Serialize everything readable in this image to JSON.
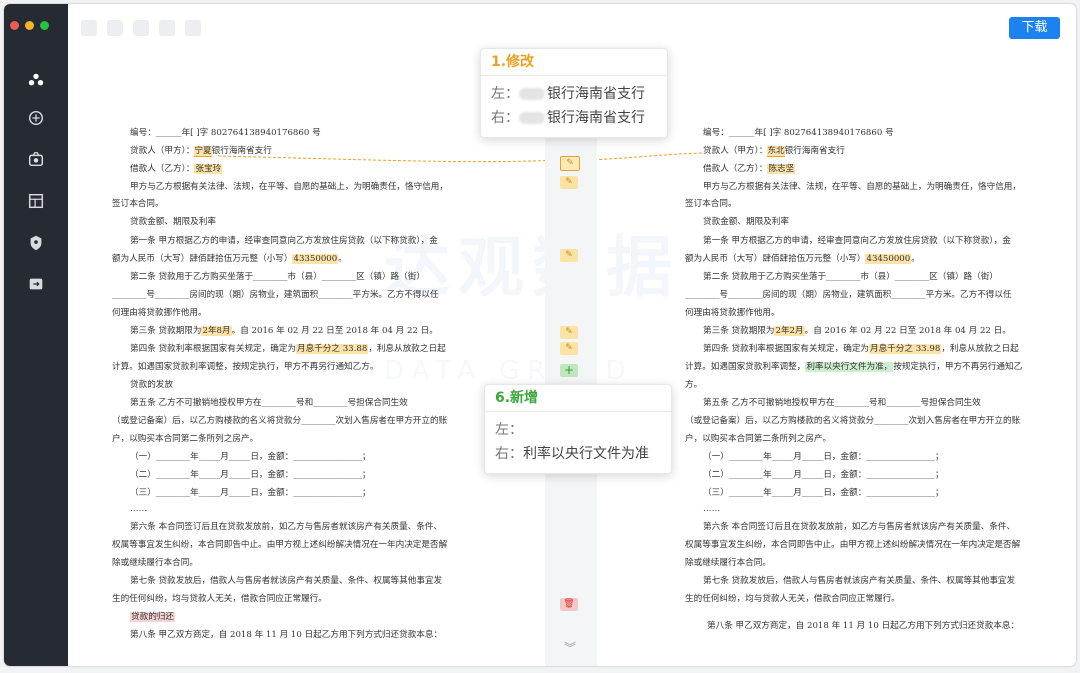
{
  "window": {
    "traffic_lights": [
      {
        "name": "close",
        "color": "#ee5b55"
      },
      {
        "name": "minimize",
        "color": "#f6b12d"
      },
      {
        "name": "maximize",
        "color": "#27c143"
      }
    ],
    "accent_color": "#1b82f0"
  },
  "sidebar": {
    "icons": [
      "logo-icon",
      "compare-icon",
      "scan-icon",
      "layout-icon",
      "shield-icon",
      "export-icon"
    ]
  },
  "toolbar": {
    "download_label": "下载"
  },
  "watermark": {
    "text": "达观数据",
    "subtext": "DATA GRAND"
  },
  "left_doc": {
    "line1": "编号：______年[ ]字 802764138940176860 号",
    "lender_label": "贷款人（甲方）：",
    "lender_hl": "宁夏",
    "lender_rest": "银行海南省支行",
    "borrower_label": "借款人（乙方）：",
    "borrower_name": "张宝玲",
    "p1": "甲方与乙方根据有关法律、法规，在平等、自愿的基础上，为明确责任，恪守信用，",
    "p1b": "签订本合同。",
    "h1": "贷款金额、期限及利率",
    "a1": "第一条  甲方根据乙方的申请，经审查同意向乙方发放住房贷款（以下称贷款），金",
    "a1b_pre": "额为人民币（大写）肆佰肆拾伍万元整（小写）",
    "a1b_amt": "43350000",
    "a1b_post": "。",
    "a2": "第二条  贷款用于乙方购买坐落于________市（县）________区（镇）路（街）",
    "a2b": "________号________房间的现（期）房物业，建筑面积________平方米。乙方不得以任",
    "a2c": "何理由将贷款挪作他用。",
    "a3_pre": "第三条  贷款期限为",
    "a3_hl": "2年8月",
    "a3_post": "。自 2016 年 02 月 22 日至 2018 年 04 月 22 日。",
    "a4_pre": "第四条  贷款利率根据国家有关规定，确定为",
    "a4_hl": "月息千分之 33.88",
    "a4_post": "，利息从放款之日起",
    "a4b": "计算。如遇国家贷款利率调整，按规定执行，甲方不再另行通知乙方。",
    "h2": "贷款的发放",
    "a5": "第五条  乙方不可撤销地授权甲方在________号和________号担保合同生效",
    "a5b": "（或登记备案）后，以乙方购楼款的名义将贷款分________次划入售房者在甲方开立的账",
    "a5c": "户，以购买本合同第二条所列之房产。",
    "i1": "（一）________年_____月_____日，金额：________________；",
    "i2": "（二）________年_____月_____日，金额：________________；",
    "i3": "（三）________年_____月_____日，金额：________________；",
    "dots": "……",
    "a6": "第六条  本合同签订后且在贷款发放前，如乙方与售房者就该房产有关质量、条件、",
    "a6b": "权属等事宜发生纠纷，本合同即告中止。由甲方视上述纠纷解决情况在一年内决定是否解",
    "a6c": "除或继续履行本合同。",
    "a7": "第七条  贷款发放后，借款人与售房者就该房产有关质量、条件、权属等其他事宜发",
    "a7b": "生的任何纠纷，均与贷款人无关，借款合同应正常履行。",
    "h3": "贷款的归还",
    "a8": "第八条  甲乙双方商定，自 2018 年 11 月 10 日起乙方用下列方式归还贷款本息："
  },
  "right_doc": {
    "line1": "编号：______年[ ]字 802764138940176860 号",
    "lender_label": "贷款人（甲方）：",
    "lender_hl": "东北",
    "lender_rest": "银行海南省支行",
    "borrower_label": "借款人（乙方）：",
    "borrower_name": "陈志坚",
    "p1": "甲方与乙方根据有关法律、法规，在平等、自愿的基础上，为明确责任，恪守信用，",
    "p1b": "签订本合同。",
    "h1": "贷款金额、期限及利率",
    "a1": "第一条  甲方根据乙方的申请，经审查同意向乙方发放住房贷款（以下称贷款），金",
    "a1b_pre": "额为人民币（大写）肆佰肆拾伍万元整（小写）",
    "a1b_amt": "43450000",
    "a1b_post": "。",
    "a2": "第二条  贷款用于乙方购买坐落于________市（县）________区（镇）路（街）",
    "a2b": "________号________房间的现（期）房物业，建筑面积________平方米。乙方不得以任",
    "a2c": "何理由将贷款挪作他用。",
    "a3_pre": "第三条  贷款期限为",
    "a3_hl": "2年2月",
    "a3_post": "。自 2016 年 02 月 22 日至 2018 年 04 月 22 日。",
    "a4_pre": "第四条  贷款利率根据国家有关规定，确定为",
    "a4_hl": "月息千分之 33.98",
    "a4_post": "，利息从放款之日起",
    "a4b_pre": "计算。如遇国家贷款利率调整，",
    "a4b_hl": "利率以央行文件为准，",
    "a4b_post": "按规定执行，甲方不再另行通知乙",
    "a4c": "方。",
    "a5": "第五条  乙方不可撤销地授权甲方在________号和________号担保合同生效",
    "a5b": "（或登记备案）后，以乙方购楼款的名义将贷款分________次划入售房者在甲方开立的账",
    "a5c": "户，以购买本合同第二条所列之房产。",
    "i1": "（一）________年_____月_____日，金额：________________；",
    "i2": "（二）________年_____月_____日，金额：________________；",
    "i3": "（三）________年_____月_____日，金额：________________；",
    "dots": "……",
    "a6": "第六条  本合同签订后且在贷款发放前，如乙方与售房者就该房产有关质量、条件、",
    "a6b": "权属等事宜发生纠纷，本合同即告中止。由甲方视上述纠纷解决情况在一年内决定是否解",
    "a6c": "除或继续履行本合同。",
    "a7": "第七条  贷款发放后，借款人与售房者就该房产有关质量、条件、权属等其他事宜发",
    "a7b": "生的任何纠纷，均与贷款人无关，借款合同应正常履行。",
    "a8": "第八条  甲乙双方商定，自 2018 年 11 月 10 日起乙方用下列方式归还贷款本息："
  },
  "popup_modify": {
    "title": "1.修改",
    "title_color": "#f0a020",
    "left_label": "左：",
    "left_value": "银行海南省支行",
    "right_label": "右：",
    "right_value": "银行海南省支行"
  },
  "popup_add": {
    "title": "6.新增",
    "title_color": "#3aa83a",
    "left_label": "左：",
    "left_value": "",
    "right_label": "右：",
    "right_value": "利率以央行文件为准"
  },
  "markers": {
    "edit_icon": "pencil-icon",
    "add_icon": "plus-icon",
    "delete_icon": "trash-icon",
    "more_icon": "chevron-double-down-icon"
  }
}
